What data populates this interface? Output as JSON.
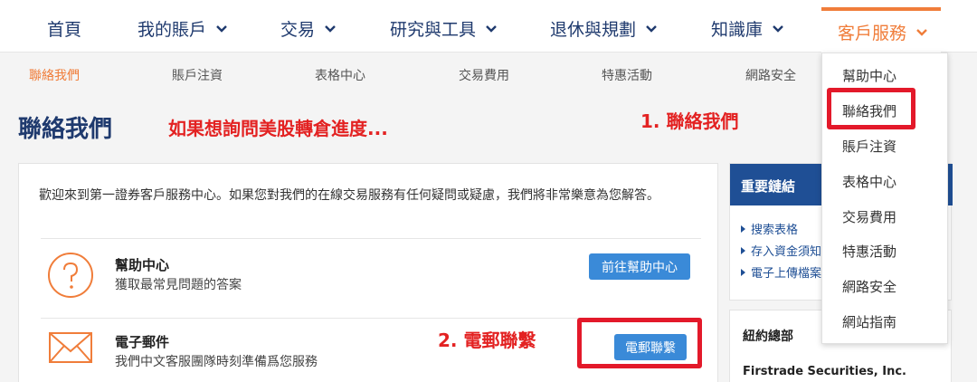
{
  "topnav": {
    "items": [
      {
        "label": "首頁"
      },
      {
        "label": "我的賬戶"
      },
      {
        "label": "交易"
      },
      {
        "label": "研究與工具"
      },
      {
        "label": "退休與規劃"
      },
      {
        "label": "知識庫"
      },
      {
        "label": "客戶服務"
      }
    ],
    "active_color": "#f07d3a",
    "text_color": "#1f3a6e"
  },
  "subnav": {
    "items": [
      {
        "label": "聯絡我們"
      },
      {
        "label": "賬戶注資"
      },
      {
        "label": "表格中心"
      },
      {
        "label": "交易費用"
      },
      {
        "label": "特惠活動"
      },
      {
        "label": "網路安全"
      }
    ]
  },
  "page": {
    "title": "聯絡我們"
  },
  "annotations": {
    "question": "如果想詢問美股轉倉進度...",
    "step1": "1. 聯絡我們",
    "step2": "2. 電郵聯繫",
    "color": "#e3192a"
  },
  "main": {
    "welcome": "歡迎來到第一證券客戶服務中心。如果您對我們的在線交易服務有任何疑問或疑慮，我們將非常樂意為您解答。",
    "rows": [
      {
        "icon": "question-circle-icon",
        "title": "幫助中心",
        "desc": "獲取最常見問題的答案",
        "button": "前往幫助中心"
      },
      {
        "icon": "envelope-icon",
        "title": "電子郵件",
        "desc": "我們中文客服團隊時刻準備爲您服務",
        "button": "電郵聯繫"
      }
    ]
  },
  "side": {
    "links_title": "重要鏈結",
    "links": [
      "搜索表格",
      "存入資金須知",
      "電子上傳檔案"
    ],
    "office_title": "紐約總部",
    "office_name": "Firstrade Securities, Inc."
  },
  "dropdown": {
    "items": [
      "幫助中心",
      "聯絡我們",
      "賬戶注資",
      "表格中心",
      "交易費用",
      "特惠活動",
      "網路安全",
      "網站指南"
    ]
  }
}
